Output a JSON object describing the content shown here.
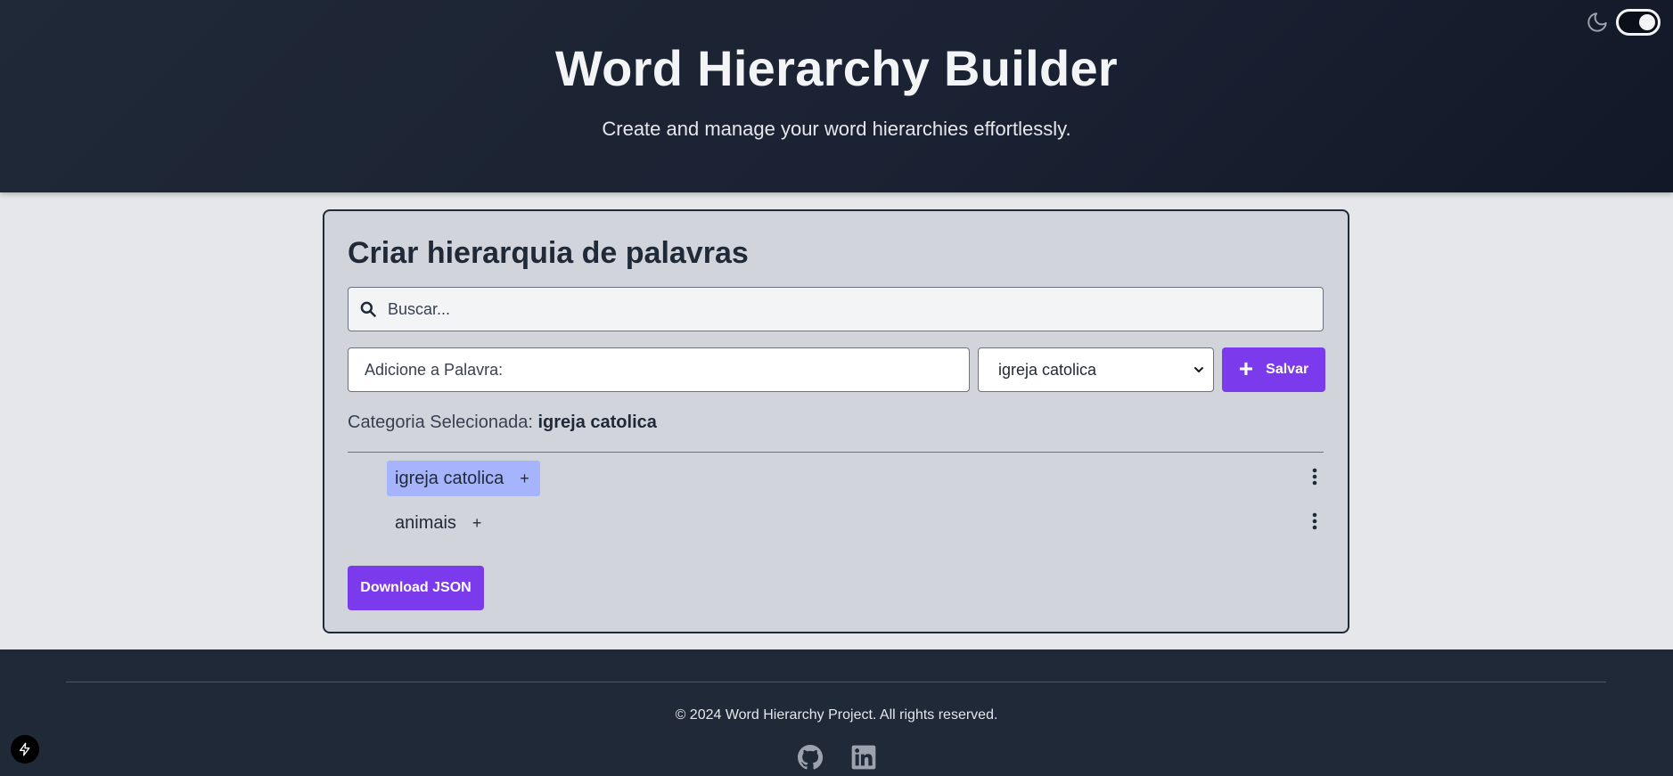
{
  "header": {
    "title": "Word Hierarchy Builder",
    "subtitle": "Create and manage your word hierarchies effortlessly."
  },
  "theme_toggle": {
    "icon": "moon-icon",
    "state": "dark"
  },
  "card": {
    "title": "Criar hierarquia de palavras",
    "search": {
      "placeholder": "Buscar...",
      "value": ""
    },
    "word_input": {
      "placeholder": "Adicione a Palavra:",
      "value": ""
    },
    "category_select": {
      "selected": "igreja catolica"
    },
    "save_label": "Salvar",
    "selected_category": {
      "label": "Categoria Selecionada:",
      "value": "igreja catolica"
    },
    "tree": [
      {
        "label": "igreja catolica",
        "add": "+",
        "active": true
      },
      {
        "label": "animais",
        "add": "+",
        "active": false
      }
    ],
    "download_label": "Download JSON"
  },
  "footer": {
    "copyright": "© 2024 Word Hierarchy Project. All rights reserved.",
    "icons": [
      "github-icon",
      "linkedin-icon"
    ]
  },
  "colors": {
    "header_bg": "#1f2937",
    "accent": "#7c3aed",
    "chip_active": "#a5b4fc",
    "card_bg": "#d1d5db",
    "page_bg": "#e5e7eb"
  }
}
